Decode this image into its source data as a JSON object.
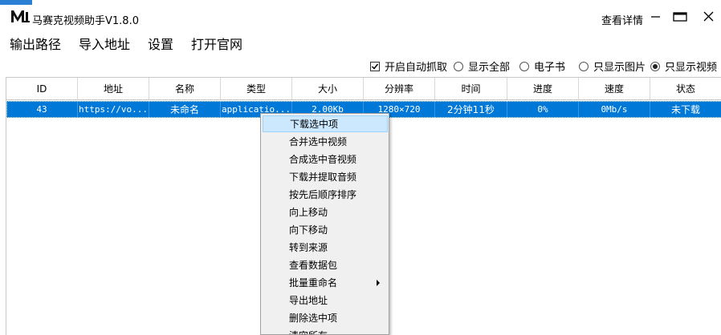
{
  "window": {
    "title": "马赛克视频助手V1.8.0",
    "view_details": "查看详情"
  },
  "menu": [
    "输出路径",
    "导入地址",
    "设置",
    "打开官网"
  ],
  "filters": {
    "auto_capture": {
      "label": "开启自动抓取",
      "checked": true
    },
    "radios": [
      {
        "label": "显示全部",
        "checked": false
      },
      {
        "label": "电子书",
        "checked": false
      },
      {
        "label": "只显示图片",
        "checked": false
      },
      {
        "label": "只显示视频",
        "checked": true
      }
    ]
  },
  "table": {
    "columns": [
      "ID",
      "地址",
      "名称",
      "类型",
      "大小",
      "分辨率",
      "时间",
      "进度",
      "速度",
      "状态"
    ],
    "rows": [
      [
        "43",
        "https://vo...",
        "未命名",
        "applicatio...",
        "2.00Kb",
        "1280×720",
        "2分钟11秒",
        "0%",
        "0Mb/s",
        "未下载"
      ]
    ]
  },
  "context_menu": {
    "items": [
      "下载选中项",
      "合并选中视频",
      "合成选中音视频",
      "下载并提取音频",
      "按先后顺序排序",
      "向上移动",
      "向下移动",
      "转到来源",
      "查看数据包",
      "批量重命名",
      "导出地址",
      "删除选中项",
      "清空所有"
    ],
    "highlighted_index": 0,
    "submenu_index": 9
  },
  "colors": {
    "selection": "#0078d7",
    "menu_highlight": "#cce8ff"
  }
}
